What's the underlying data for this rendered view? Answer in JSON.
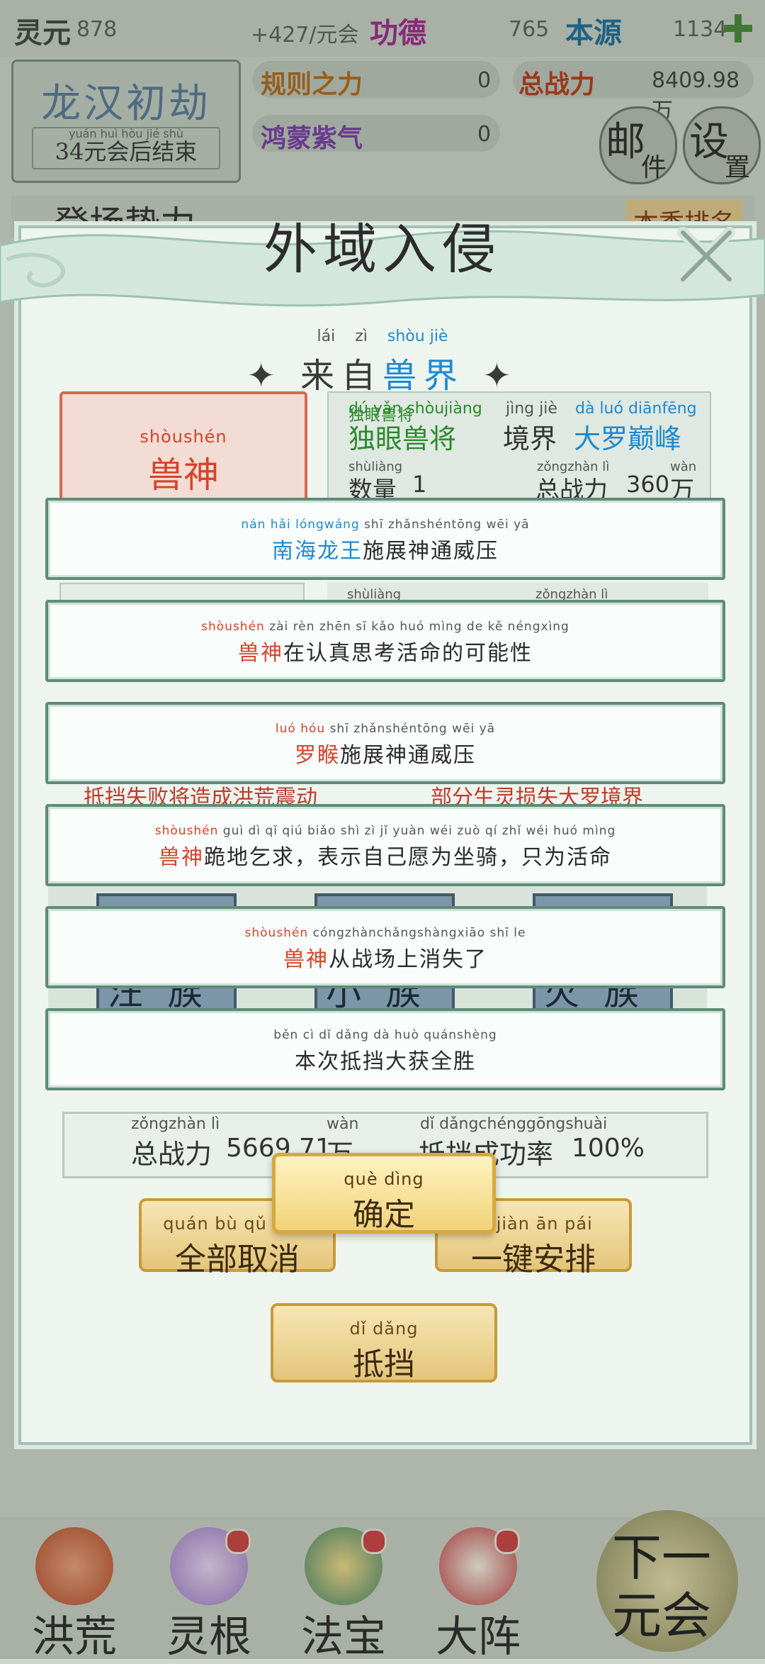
{
  "topbar": {
    "lingyuan": {
      "name": "灵元",
      "value": "878",
      "delta": "+427/元会"
    },
    "gongde": {
      "name": "功德",
      "value": "765"
    },
    "benyuan": {
      "name": "本源",
      "value": "1134"
    },
    "icons": {
      "plus": "plus-icon"
    }
  },
  "era": {
    "pinyin": "yuán huì hòu jié shù",
    "title": "龙汉初劫",
    "subtitle": "34元会后结束"
  },
  "stats": {
    "guize": {
      "name": "规则之力",
      "value": "0"
    },
    "zongzhanli": {
      "name": "总战力",
      "value": "8409.98万",
      "pinyin": "wàn"
    },
    "hongmeng": {
      "name": "鸿蒙紫气",
      "value": "0"
    }
  },
  "mail_button": {
    "chars": [
      "邮",
      "件"
    ]
  },
  "settings_button": {
    "chars": [
      "设",
      "置"
    ]
  },
  "bg_partial": {
    "left": "登场势力",
    "right": "本季排名"
  },
  "modal": {
    "title": "外域入侵",
    "source": {
      "pinyin": [
        "lái",
        "zì",
        "shòu",
        "jiè"
      ],
      "label": "来自",
      "realm": "兽界"
    },
    "beast": {
      "pinyin": "shòushén",
      "name": "兽神"
    },
    "general": {
      "pinyin": "dú yǎn shòujiàng",
      "name": "独眼兽将",
      "jingjie_py": "jìng jiè",
      "jingjie": "境界",
      "level_py": "dà luó diānfēng",
      "level": "大罗巅峰"
    },
    "quantity": {
      "pinyin": "shùliàng",
      "label": "数量",
      "value": "1",
      "zhanli_py": "zǒngzhàn lì",
      "zhanli_label": "总战力",
      "zhanli_value": "360",
      "unit_py": "wàn",
      "unit": "万"
    },
    "hidden_row": {
      "a": "shùliàng",
      "b": "zǒngzhàn lì"
    },
    "lower_labels": {
      "left": "抵挡失败将造成洪荒震动",
      "right": "部分生灵损失大罗境界"
    },
    "cards": [
      {
        "a": "汪",
        "b": "族"
      },
      {
        "a": "小",
        "b": "族"
      },
      {
        "a": "火",
        "b": "族"
      }
    ],
    "total": {
      "pinyin": "zǒngzhàn lì",
      "label": "总战力",
      "value": "5669.71",
      "unit_py": "wàn",
      "unit": "万"
    },
    "success": {
      "pinyin": "dǐ dǎngchénggōngshuài",
      "label": "抵挡成功率",
      "value": "100%"
    },
    "cancel_all": {
      "pinyin": "quán bù qǔ xiāo",
      "label": "全部取消"
    },
    "auto_arrange": {
      "pinyin": "yī jiàn ān pái",
      "label": "一键安排"
    },
    "resist": {
      "pinyin": "dǐ dǎng",
      "label": "抵挡"
    },
    "confirm": {
      "pinyin": "què dìng",
      "label": "确定"
    },
    "close_icon": "close-icon"
  },
  "messages": [
    {
      "pinyin_hl": "nán hǎi lóngwáng",
      "pinyin_rest": " shī zhǎnshéntōng wēi yā",
      "hl": "南海龙王",
      "rest": "施展神通威压",
      "color": "blue"
    },
    {
      "pinyin_hl": "shòushén",
      "pinyin_rest": " zài rèn zhēn sī kǎo huó mìng de kě néngxìng",
      "hl": "兽神",
      "rest": "在认真思考活命的可能性",
      "color": "red"
    },
    {
      "pinyin_hl": "luó hóu",
      "pinyin_rest": " shī zhǎnshéntōng wēi yā",
      "hl": "罗睺",
      "rest": "施展神通威压",
      "color": "red"
    },
    {
      "pinyin_hl": "shòushén",
      "pinyin_rest": " guì dì qǐ qiú   biǎo shì zì jǐ yuàn wéi zuò qí   zhǐ wéi huó mìng",
      "hl": "兽神",
      "rest": "跪地乞求，表示自己愿为坐骑，只为活命",
      "color": "red"
    },
    {
      "pinyin_hl": "shòushén",
      "pinyin_rest": " cóngzhànchǎngshàngxiāo shī le",
      "hl": "兽神",
      "rest": "从战场上消失了",
      "color": "red"
    },
    {
      "pinyin_hl": "",
      "pinyin_rest": "běn cì dǐ dǎng dà huò quánshèng",
      "hl": "",
      "rest": "本次抵挡大获全胜",
      "color": "dark"
    }
  ],
  "bottom_nav": [
    {
      "label": "洪荒",
      "icon": "volcano-icon",
      "badge": false
    },
    {
      "label": "灵根",
      "icon": "lotus-icon",
      "badge": true
    },
    {
      "label": "法宝",
      "icon": "treasure-icon",
      "badge": true
    },
    {
      "label": "大阵",
      "icon": "formation-icon",
      "badge": true
    }
  ],
  "next_era": {
    "label": "下一元会"
  }
}
